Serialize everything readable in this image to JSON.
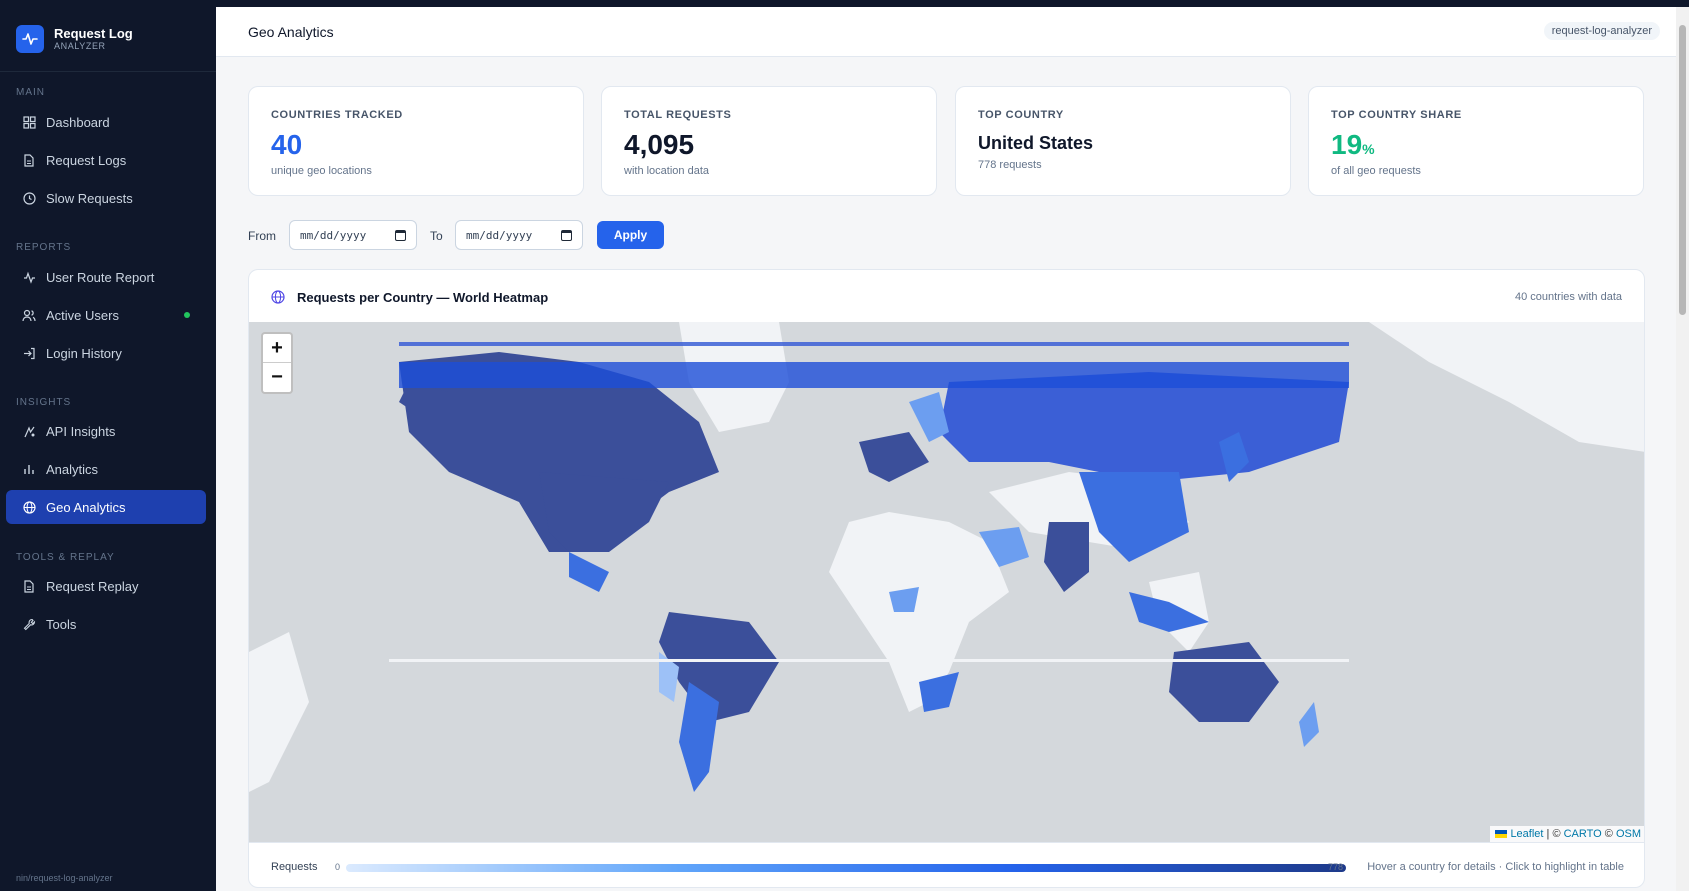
{
  "app": {
    "name": "Request Log",
    "subtitle": "ANALYZER"
  },
  "nav": {
    "sections": [
      {
        "title": "MAIN",
        "items": [
          {
            "label": "Dashboard",
            "icon": "grid-icon"
          },
          {
            "label": "Request Logs",
            "icon": "file-icon"
          },
          {
            "label": "Slow Requests",
            "icon": "clock-icon"
          }
        ]
      },
      {
        "title": "REPORTS",
        "items": [
          {
            "label": "User Route Report",
            "icon": "activity-icon"
          },
          {
            "label": "Active Users",
            "icon": "users-icon"
          },
          {
            "label": "Login History",
            "icon": "login-icon"
          }
        ]
      },
      {
        "title": "INSIGHTS",
        "items": [
          {
            "label": "API Insights",
            "icon": "sparkle-icon"
          },
          {
            "label": "Analytics",
            "icon": "bar-chart-icon"
          },
          {
            "label": "Geo Analytics",
            "icon": "globe-icon"
          }
        ]
      },
      {
        "title": "TOOLS & REPLAY",
        "items": [
          {
            "label": "Request Replay",
            "icon": "file-icon"
          },
          {
            "label": "Tools",
            "icon": "wrench-icon"
          }
        ]
      }
    ],
    "active": "Geo Analytics",
    "footer": "nin/request-log-analyzer"
  },
  "header": {
    "title": "Geo Analytics",
    "badge": "request-log-analyzer"
  },
  "stats": [
    {
      "label": "COUNTRIES TRACKED",
      "value": "40",
      "sub": "unique geo locations",
      "color": "#2563eb"
    },
    {
      "label": "TOTAL REQUESTS",
      "value": "4,095",
      "sub": "with location data",
      "color": "#0f172a"
    },
    {
      "label": "TOP COUNTRY",
      "value": "United States",
      "sub": "778 requests",
      "color": "#0f172a"
    },
    {
      "label": "TOP COUNTRY SHARE",
      "value": "19",
      "unit": "%",
      "sub": "of all geo requests",
      "color": "#10b981"
    }
  ],
  "filters": {
    "from_label": "From",
    "to_label": "To",
    "from_placeholder": "mm/dd/yyyy",
    "to_placeholder": "mm/dd/yyyy",
    "apply_label": "Apply"
  },
  "map": {
    "title": "Requests per Country — World Heatmap",
    "count_text": "40 countries with data",
    "zoom_in": "+",
    "zoom_out": "−",
    "attribution": {
      "leaflet": "Leaflet",
      "sep1": " | © ",
      "carto": "CARTO",
      "sep2": " © ",
      "osm": "OSM"
    },
    "legend": {
      "label": "Requests",
      "min": "0",
      "max": "778",
      "hint": "Hover a country for details · Click to highlight in table"
    },
    "colors": {
      "ocean": "#d4d8dc",
      "land_none": "#f1f3f6",
      "low": "#93c5fd",
      "mid": "#3b82f6",
      "high": "#1d4ed8",
      "max": "#1e3a8a"
    }
  }
}
